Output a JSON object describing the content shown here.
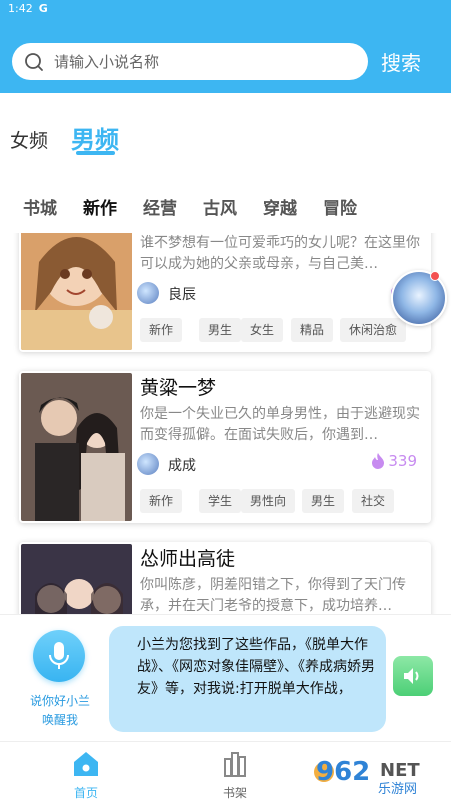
{
  "status_bar": {
    "time": "1:42",
    "indicator": "G"
  },
  "search": {
    "placeholder": "请输入小说名称",
    "button_label": "搜索"
  },
  "gender_tabs": [
    {
      "label": "女频",
      "active": false
    },
    {
      "label": "男频",
      "active": true
    }
  ],
  "category_tabs": [
    {
      "label": "书城",
      "active": false
    },
    {
      "label": "新作",
      "active": true
    },
    {
      "label": "经营",
      "active": false
    },
    {
      "label": "古风",
      "active": false
    },
    {
      "label": "穿越",
      "active": false
    },
    {
      "label": "冒险",
      "active": false
    }
  ],
  "books": [
    {
      "title": "",
      "description": "谁不梦想有一位可爱乖巧的女儿呢？在这里你可以成为她的父亲或母亲，与自己美…",
      "author": "良辰",
      "heat": "3",
      "tags": [
        "新作",
        "男生",
        "女生",
        "精品",
        "休闲治愈"
      ]
    },
    {
      "title": "黄粱一梦",
      "description": "你是一个失业已久的单身男性，由于逃避现实而变得孤僻。在面试失败后，你遇到…",
      "author": "成成",
      "heat": "339",
      "tags": [
        "新作",
        "学生",
        "男性向",
        "男生",
        "社交"
      ]
    },
    {
      "title": "怂师出高徒",
      "description": "你叫陈彦，阴差阳错之下，你得到了天门传承，并在天门老爷的授意下，成功培养…",
      "author": "",
      "heat": "",
      "tags": []
    }
  ],
  "voice": {
    "hint": "说你好小兰唤醒我",
    "bubble_text": "小兰为您找到了这些作品，《脱单大作战》、《网恋对象佳隔壁》、《养成病娇男友》等，对我说:打开脱单大作战，"
  },
  "bottom_nav": [
    {
      "label": "首页",
      "active": true
    },
    {
      "label": "书架",
      "active": false
    }
  ],
  "watermark": {
    "text": "962",
    "suffix": "NET",
    "sub": "乐游网"
  },
  "colors": {
    "accent": "#3db6f2",
    "heat": "#c78bf0",
    "bubble": "#bfe6fb"
  }
}
